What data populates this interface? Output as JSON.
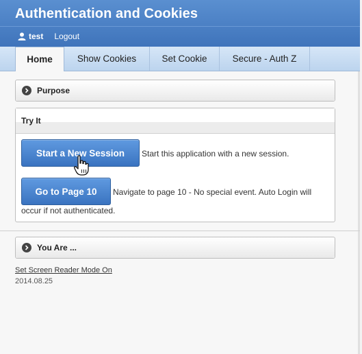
{
  "header": {
    "title": "Authentication and Cookies",
    "user": "test",
    "logout": "Logout"
  },
  "tabs": [
    {
      "label": "Home",
      "active": true
    },
    {
      "label": "Show Cookies",
      "active": false
    },
    {
      "label": "Set Cookie",
      "active": false
    },
    {
      "label": "Secure - Auth Z",
      "active": false
    }
  ],
  "panels": {
    "purpose": {
      "title": "Purpose"
    },
    "try_it": {
      "title": "Try It",
      "start_button": "Start a New Session",
      "start_desc": "Start this application with a new session.",
      "page10_button": "Go to Page 10",
      "page10_desc_line1": "Navigate to page 10 - No special event. Auto Login will",
      "page10_desc_line2": "occur if not authenticated."
    },
    "you_are": {
      "title": "You Are ..."
    }
  },
  "footer": {
    "screen_reader_link": "Set Screen Reader Mode On",
    "version": "2014.08.25"
  },
  "colors": {
    "header_blue": "#3f74bb",
    "button_blue": "#3a73c0",
    "tab_bar": "#c8dcf2"
  },
  "icons": [
    "user-icon",
    "chevron-right-icon",
    "hand-pointer-icon"
  ]
}
